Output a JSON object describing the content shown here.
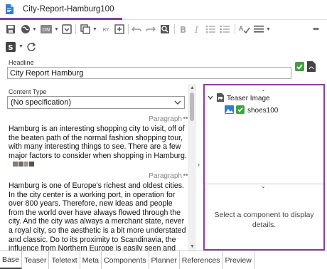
{
  "document": {
    "tab_title": "City-Report-Hamburg100"
  },
  "toolbar": {
    "locale_badge": "DN",
    "ry_badge": "RY",
    "more_label": "•••"
  },
  "headline": {
    "label": "Headline",
    "value": "City Report Hamburg"
  },
  "content_type": {
    "label": "Content Type",
    "selected": "(No specification)"
  },
  "paragraphs": [
    {
      "label": "Paragraph",
      "more": "•••",
      "text": "Hamburg is an interesting shopping city to visit, off of the beaten path of the normal fashion shopping tour, with many interesting things to see. There are a few major factors to consider when shopping in Hamburg."
    },
    {
      "label": "Paragraph",
      "more": "•••",
      "text": "Hamburg is one of Europe's richest and oldest cities. In the city center is a working port, in operation for over 800 years. Therefore, new ideas and people from the world over have always flowed through the city. And the city was always a merchant state, never a royal city, so the aesthetic is a bit more understated and classic. Do to its proximity to Scandinavia, the influence from Northern Europe is easily seen and felt."
    }
  ],
  "component_tree": {
    "root_label": "Teaser Image",
    "child_label": "shoes100"
  },
  "details_message": "Select a component to display details.",
  "bottom_tabs": [
    {
      "label": "Base",
      "active": true
    },
    {
      "label": "Teaser",
      "active": false
    },
    {
      "label": "Teletext",
      "active": false
    },
    {
      "label": "Meta",
      "active": false
    },
    {
      "label": "Components",
      "active": false
    },
    {
      "label": "Planner",
      "active": false
    },
    {
      "label": "References",
      "active": false
    },
    {
      "label": "Preview",
      "active": false
    }
  ],
  "colors": {
    "accent": "#8a3fa6",
    "check_green": "#3ea33e",
    "doc_icon_blue": "#2f7fd1"
  }
}
